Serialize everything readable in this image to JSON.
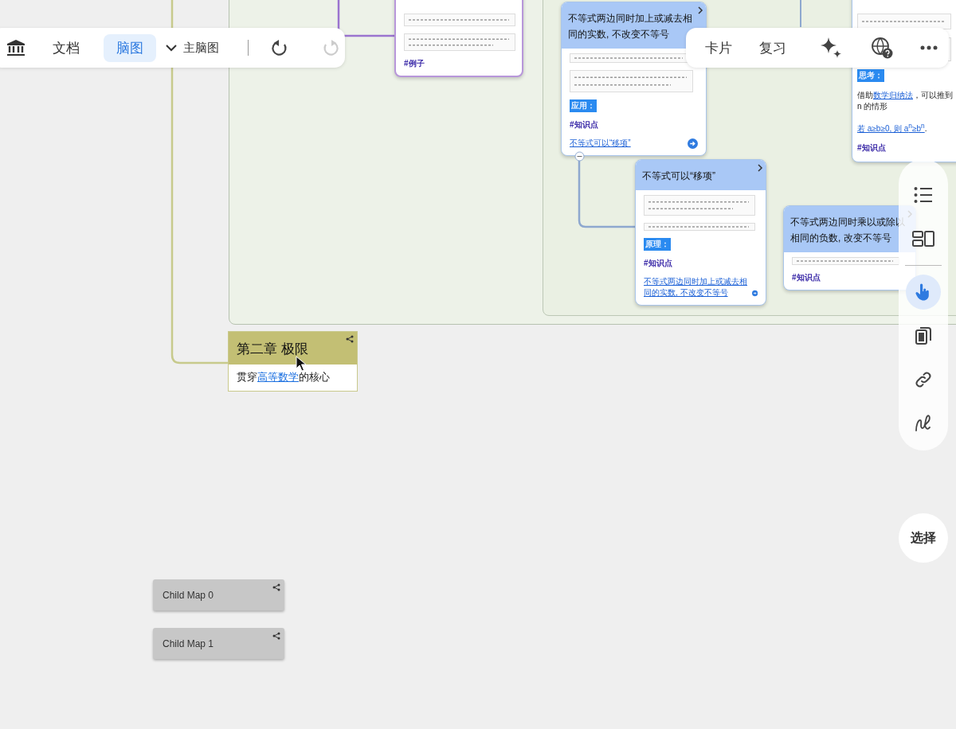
{
  "top_toolbar": {
    "tabs": [
      {
        "label": "文档",
        "selected": false
      },
      {
        "label": "脑图",
        "selected": true
      }
    ],
    "map_menu": {
      "label": "主脑图"
    },
    "undo": {
      "disabled": false
    },
    "redo": {
      "disabled": true
    }
  },
  "view_toolbar": {
    "buttons": [
      {
        "label": "卡片"
      },
      {
        "label": "复习"
      }
    ]
  },
  "canvas": {
    "example_card": {
      "tag": "#例子"
    },
    "cards": [
      {
        "title": "不等式两边同时加上或减去相同的实数, 不改变不等号",
        "label": "应用：",
        "tag": "#知识点",
        "link": "不等式可以“移项”"
      },
      {
        "title": "不等式可以“移项”",
        "label": "原理：",
        "tag": "#知识点",
        "link": "不等式两边同时加上或减去相同的实数, 不改变不等号"
      },
      {
        "title": "不等式两边同时乘以或除以相同的负数, 改变不等号",
        "tag": "#知识点"
      }
    ],
    "side_card": {
      "label": "思考：",
      "text_before": "借助",
      "text_link": "数学归纳法",
      "text_after": "，可以推到",
      "text_line2": "n 的情形",
      "formula_link": "若 a≥b≥0, 则 a$^{n}$≥b$^{n}$",
      "formula_end": ".",
      "tag": "#知识点"
    },
    "chapter": {
      "title": "第二章 极限",
      "text_before": "贯穿",
      "link": "高等数学",
      "text_after": "的核心"
    },
    "child_maps": [
      {
        "label": "Child Map 0"
      },
      {
        "label": "Child Map 1"
      }
    ]
  },
  "side_toolbar": {
    "tools": [
      {
        "kind": "outline",
        "selected": false
      },
      {
        "kind": "layout",
        "selected": false
      },
      {
        "kind": "pointer",
        "selected": true
      },
      {
        "kind": "copy",
        "selected": false
      },
      {
        "kind": "link",
        "selected": false
      },
      {
        "kind": "draw",
        "selected": false
      }
    ]
  },
  "select_button": {
    "label": "选择"
  }
}
